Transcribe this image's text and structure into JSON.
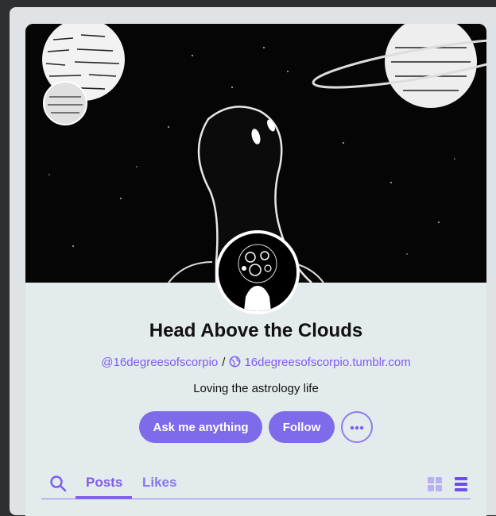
{
  "blog": {
    "title": "Head Above the Clouds",
    "username": "@16degreesofscorpio",
    "separator": "/",
    "url": "16degreesofscorpio.tumblr.com",
    "description": "Loving the astrology life"
  },
  "actions": {
    "ask_label": "Ask me anything",
    "follow_label": "Follow",
    "more_icon": "ellipsis-icon"
  },
  "tabs": {
    "search_icon": "search-icon",
    "posts_label": "Posts",
    "likes_label": "Likes",
    "active": "Posts",
    "grid_icon": "grid-view-icon",
    "list_icon": "list-view-icon"
  },
  "colors": {
    "accent": "#7c5cf0",
    "button": "#7e6bea",
    "card_background": "#e4ebec"
  }
}
